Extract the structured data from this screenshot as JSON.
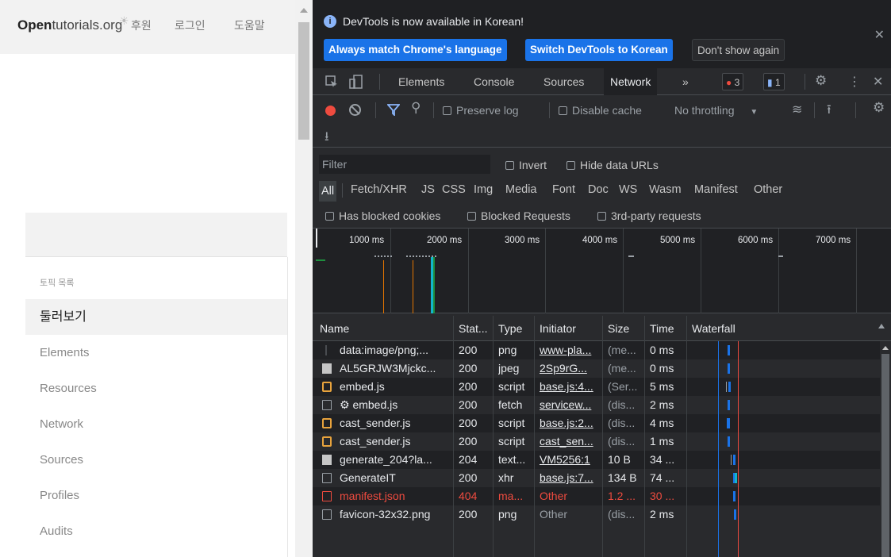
{
  "page": {
    "brand_bold": "Open",
    "brand_rest": "tutorials.org",
    "nav": [
      "후원",
      "로그인",
      "도움말"
    ],
    "section_title": "토픽 목록",
    "menu": [
      "둘러보기",
      "Elements",
      "Resources",
      "Network",
      "Sources",
      "Profiles",
      "Audits"
    ],
    "active_menu": "둘러보기"
  },
  "devtools": {
    "info": {
      "text": "DevTools is now available in Korean!",
      "btn_match": "Always match Chrome's language",
      "btn_switch": "Switch DevTools to Korean",
      "btn_dismiss": "Don't show again"
    },
    "tabs": [
      "Elements",
      "Console",
      "Sources",
      "Network"
    ],
    "active_tab": "Network",
    "more": "»",
    "errors_count": "3",
    "messages_count": "1",
    "toolbar": {
      "preserve_log": "Preserve log",
      "disable_cache": "Disable cache",
      "throttling": "No throttling"
    },
    "filter_placeholder": "Filter",
    "invert": "Invert",
    "hide_data_urls": "Hide data URLs",
    "types": [
      "All",
      "Fetch/XHR",
      "JS",
      "CSS",
      "Img",
      "Media",
      "Font",
      "Doc",
      "WS",
      "Wasm",
      "Manifest",
      "Other"
    ],
    "blocked": {
      "has_blocked_cookies": "Has blocked cookies",
      "blocked_requests": "Blocked Requests",
      "third_party": "3rd-party requests"
    },
    "timeline_ticks": [
      "1000 ms",
      "2000 ms",
      "3000 ms",
      "4000 ms",
      "5000 ms",
      "6000 ms",
      "7000 ms"
    ],
    "columns": [
      "Name",
      "Stat...",
      "Type",
      "Initiator",
      "Size",
      "Time",
      "Waterfall"
    ],
    "rows": [
      {
        "name": "data:image/png;...",
        "status": "200",
        "type": "png",
        "initiator": "www-pla...",
        "size": "(me...",
        "time": "0 ms",
        "icon": "data-icon",
        "init_link": true
      },
      {
        "name": "AL5GRJW3Mjckc...",
        "status": "200",
        "type": "jpeg",
        "initiator": "2Sp9rG...",
        "size": "(me...",
        "time": "0 ms",
        "icon": "image-icon",
        "init_link": true
      },
      {
        "name": "embed.js",
        "status": "200",
        "type": "script",
        "initiator": "base.js:4...",
        "size": "(Ser...",
        "time": "5 ms",
        "icon": "script-icon",
        "init_link": true
      },
      {
        "name": "⚙ embed.js",
        "status": "200",
        "type": "fetch",
        "initiator": "servicew...",
        "size": "(dis...",
        "time": "2 ms",
        "icon": "fetch-icon",
        "init_link": true
      },
      {
        "name": "cast_sender.js",
        "status": "200",
        "type": "script",
        "initiator": "base.js:2...",
        "size": "(dis...",
        "time": "4 ms",
        "icon": "script-icon",
        "init_link": true
      },
      {
        "name": "cast_sender.js",
        "status": "200",
        "type": "script",
        "initiator": "cast_sen...",
        "size": "(dis...",
        "time": "1 ms",
        "icon": "script-icon",
        "init_link": true
      },
      {
        "name": "generate_204?la...",
        "status": "204",
        "type": "text...",
        "initiator": "VM5256:1",
        "size": "10 B",
        "time": "34 ...",
        "icon": "doc-icon",
        "init_link": true
      },
      {
        "name": "GenerateIT",
        "status": "200",
        "type": "xhr",
        "initiator": "base.js:7...",
        "size": "134 B",
        "time": "74 ...",
        "icon": "xhr-icon",
        "init_link": true
      },
      {
        "name": "manifest.json",
        "status": "404",
        "type": "ma...",
        "initiator": "Other",
        "size": "1.2 ...",
        "time": "30 ...",
        "icon": "manifest-icon",
        "init_link": false,
        "error": true
      },
      {
        "name": "favicon-32x32.png",
        "status": "200",
        "type": "png",
        "initiator": "Other",
        "size": "(dis...",
        "time": "2 ms",
        "icon": "png-icon",
        "init_link": false
      }
    ]
  }
}
